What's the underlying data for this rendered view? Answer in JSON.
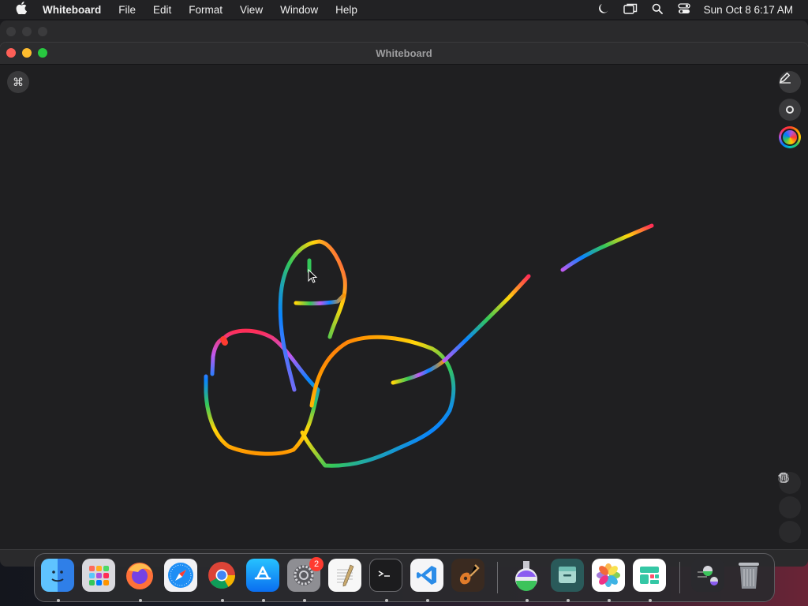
{
  "menubar": {
    "app_name": "Whiteboard",
    "items": [
      "File",
      "Edit",
      "Format",
      "View",
      "Window",
      "Help"
    ],
    "clock": "Sun Oct 8  6:17 AM"
  },
  "window": {
    "title": "Whiteboard"
  },
  "toolbar": {
    "command_symbol": "⌘"
  },
  "dock": {
    "settings_badge": "2",
    "apps": [
      "Finder",
      "Launchpad",
      "Firefox",
      "Safari",
      "Chrome",
      "App Store",
      "System Settings",
      "TextEdit",
      "Terminal",
      "VS Code",
      "GarageBand",
      "Potion",
      "Files",
      "Photos",
      "Dashboard",
      "Potion Downloads",
      "Trash"
    ]
  },
  "colors": {
    "close": "#fe5f57",
    "minimize": "#febc2e",
    "maximize": "#28c840",
    "canvas": "#1f1f21"
  }
}
